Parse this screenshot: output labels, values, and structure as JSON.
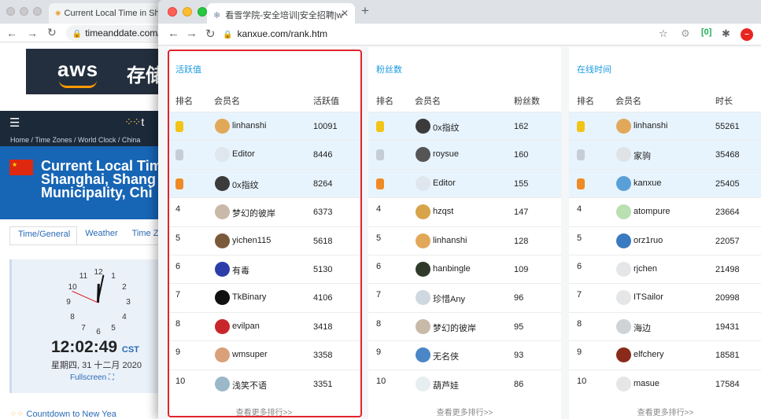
{
  "background_window": {
    "tab_title": "Current Local Time in Shan",
    "url": "timeanddate.com/",
    "ad_logo": "aws",
    "ad_text": "存储",
    "nav_logo": "t",
    "breadcrumb": "Home / Time Zones / World Clock / China",
    "header_title_lines": [
      "Current Local Tim",
      "Shanghai, Shang",
      "Municipality, Chi"
    ],
    "tabs": [
      {
        "label": "Time/General",
        "active": true
      },
      {
        "label": "Weather",
        "active": false
      },
      {
        "label": "Time Z",
        "active": false
      }
    ],
    "clock_numbers": [
      "12",
      "1",
      "2",
      "3",
      "4",
      "5",
      "6",
      "7",
      "8",
      "9",
      "10",
      "11"
    ],
    "time": "12:02:49",
    "tz": "CST",
    "date": "星期四, 31 十二月 2020",
    "fullscreen": "Fullscreen",
    "countdown": "Countdown to New Yea"
  },
  "front_window": {
    "tab_title": "看雪学院-安全培训|安全招聘|w",
    "url": "kanxue.com/rank.htm"
  },
  "panels": [
    {
      "title": "活跃值",
      "headers": [
        "排名",
        "会员名",
        "活跃值"
      ],
      "more": "查看更多排行>>",
      "rows": [
        {
          "rank": "1",
          "medal": "gold",
          "name": "linhanshi",
          "value": "10091",
          "avatar": "#e2a85a"
        },
        {
          "rank": "2",
          "medal": "silver",
          "name": "Editor",
          "value": "8446",
          "avatar": "#dfe6ee"
        },
        {
          "rank": "3",
          "medal": "bronze",
          "name": "0x指纹",
          "value": "8264",
          "avatar": "#3b3b3b"
        },
        {
          "rank": "4",
          "medal": "",
          "name": "梦幻的彼岸",
          "value": "6373",
          "avatar": "#c9b9a8"
        },
        {
          "rank": "5",
          "medal": "",
          "name": "yichen115",
          "value": "5618",
          "avatar": "#7a5a3a"
        },
        {
          "rank": "6",
          "medal": "",
          "name": "有毒",
          "value": "5130",
          "avatar": "#2b3ea8"
        },
        {
          "rank": "7",
          "medal": "",
          "name": "TkBinary",
          "value": "4106",
          "avatar": "#111111"
        },
        {
          "rank": "8",
          "medal": "",
          "name": "evilpan",
          "value": "3418",
          "avatar": "#c8262b"
        },
        {
          "rank": "9",
          "medal": "",
          "name": "wmsuper",
          "value": "3358",
          "avatar": "#d9a07a"
        },
        {
          "rank": "10",
          "medal": "",
          "name": "浅笑不语",
          "value": "3351",
          "avatar": "#9ab8c8"
        }
      ]
    },
    {
      "title": "粉丝数",
      "headers": [
        "排名",
        "会员名",
        "粉丝数"
      ],
      "more": "查看更多排行>>",
      "rows": [
        {
          "rank": "1",
          "medal": "gold",
          "name": "0x指纹",
          "value": "162",
          "avatar": "#3b3b3b"
        },
        {
          "rank": "2",
          "medal": "silver",
          "name": "roysue",
          "value": "160",
          "avatar": "#555555"
        },
        {
          "rank": "3",
          "medal": "bronze",
          "name": "Editor",
          "value": "155",
          "avatar": "#dfe6ee"
        },
        {
          "rank": "4",
          "medal": "",
          "name": "hzqst",
          "value": "147",
          "avatar": "#d8a44a"
        },
        {
          "rank": "5",
          "medal": "",
          "name": "linhanshi",
          "value": "128",
          "avatar": "#e2a85a"
        },
        {
          "rank": "6",
          "medal": "",
          "name": "hanbingle",
          "value": "109",
          "avatar": "#2f3a2a"
        },
        {
          "rank": "7",
          "medal": "",
          "name": "珍惜Any",
          "value": "96",
          "avatar": "#cfd8de"
        },
        {
          "rank": "8",
          "medal": "",
          "name": "梦幻的彼岸",
          "value": "95",
          "avatar": "#c9b9a8"
        },
        {
          "rank": "9",
          "medal": "",
          "name": "无名侠",
          "value": "93",
          "avatar": "#4a86c8"
        },
        {
          "rank": "10",
          "medal": "",
          "name": "葫芦娃",
          "value": "86",
          "avatar": "#e6eef2"
        }
      ]
    },
    {
      "title": "在线时间",
      "headers": [
        "排名",
        "会员名",
        "时长"
      ],
      "more": "查看更多排行>>",
      "rows": [
        {
          "rank": "1",
          "medal": "gold",
          "name": "linhanshi",
          "value": "55261",
          "avatar": "#e2a85a"
        },
        {
          "rank": "2",
          "medal": "silver",
          "name": "家驹",
          "value": "35468",
          "avatar": "#dfe3e6"
        },
        {
          "rank": "3",
          "medal": "bronze",
          "name": "kanxue",
          "value": "25405",
          "avatar": "#5aa0d8"
        },
        {
          "rank": "4",
          "medal": "",
          "name": "atompure",
          "value": "23664",
          "avatar": "#b9e0b0"
        },
        {
          "rank": "5",
          "medal": "",
          "name": "orz1ruo",
          "value": "22057",
          "avatar": "#3a7ac0"
        },
        {
          "rank": "6",
          "medal": "",
          "name": "rjchen",
          "value": "21498",
          "avatar": "#e4e6e8"
        },
        {
          "rank": "7",
          "medal": "",
          "name": "ITSailor",
          "value": "20998",
          "avatar": "#e4e6e8"
        },
        {
          "rank": "8",
          "medal": "",
          "name": "海边",
          "value": "19431",
          "avatar": "#cfd3d6"
        },
        {
          "rank": "9",
          "medal": "",
          "name": "elfchery",
          "value": "18581",
          "avatar": "#8a2a1a"
        },
        {
          "rank": "10",
          "medal": "",
          "name": "masue",
          "value": "17584",
          "avatar": "#e4e6e8"
        }
      ]
    }
  ]
}
